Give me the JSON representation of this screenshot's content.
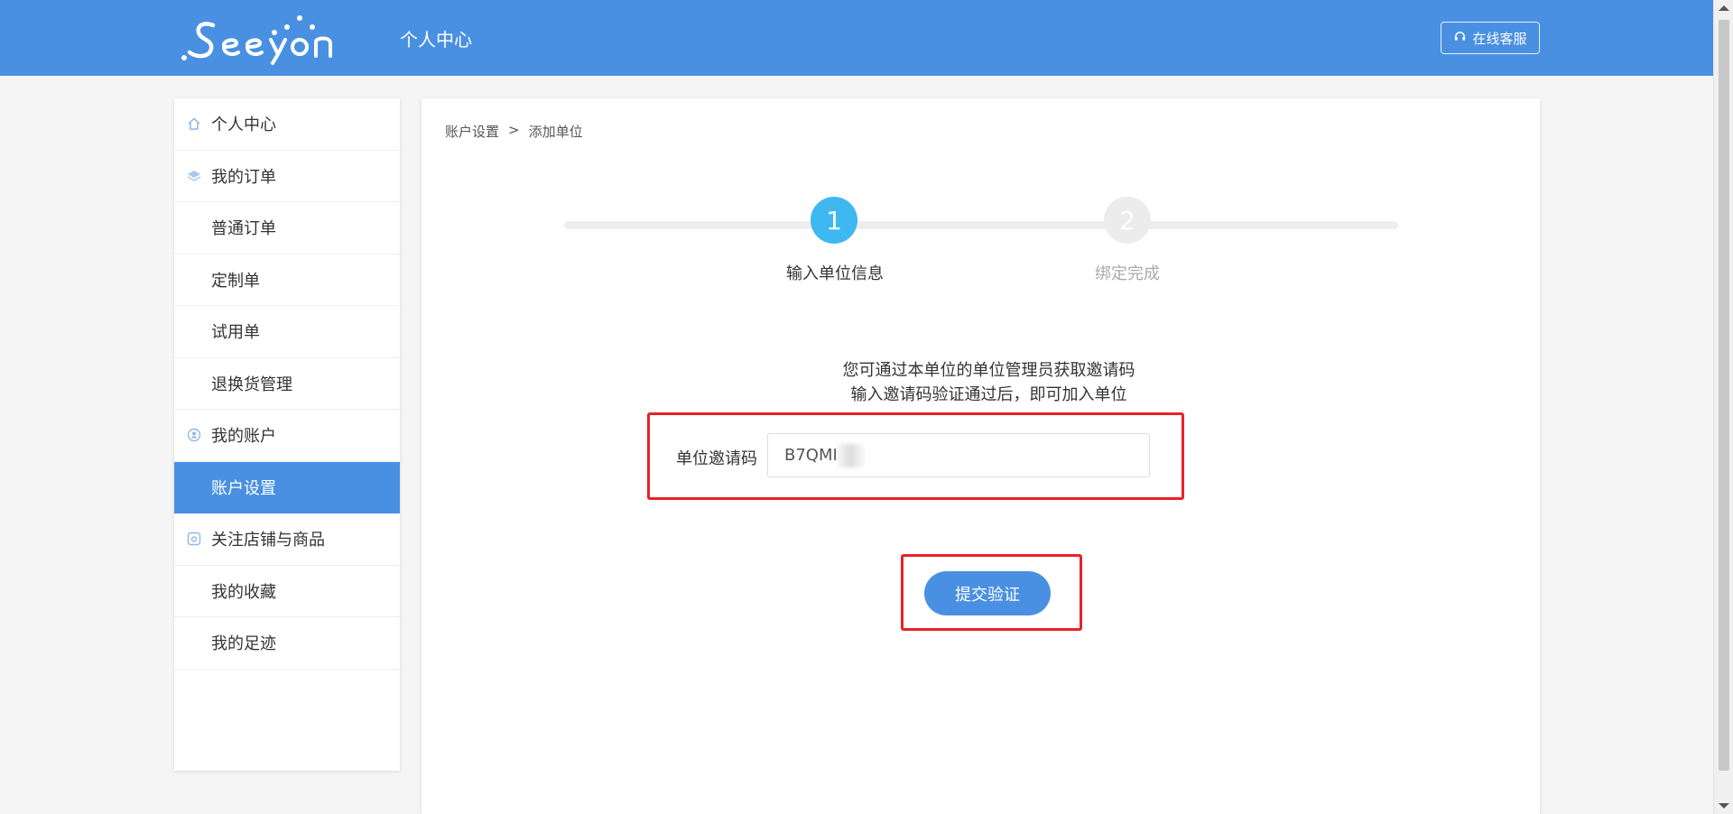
{
  "header": {
    "logo_text": "Seeyon",
    "title": "个人中心",
    "service_button": "在线客服"
  },
  "sidebar": {
    "items": [
      {
        "label": "个人中心",
        "icon": "home-icon"
      },
      {
        "label": "我的订单",
        "icon": "layers-icon"
      },
      {
        "label": "普通订单"
      },
      {
        "label": "定制单"
      },
      {
        "label": "试用单"
      },
      {
        "label": "退换货管理"
      },
      {
        "label": "我的账户",
        "icon": "user-circle-icon"
      },
      {
        "label": "账户设置",
        "active": true
      },
      {
        "label": "关注店铺与商品",
        "icon": "store-icon"
      },
      {
        "label": "我的收藏"
      },
      {
        "label": "我的足迹"
      }
    ]
  },
  "main": {
    "breadcrumb": {
      "parent": "账户设置",
      "separator": ">",
      "current": "添加单位"
    },
    "steps": [
      {
        "number": "1",
        "label": "输入单位信息",
        "status": "active"
      },
      {
        "number": "2",
        "label": "绑定完成",
        "status": "pending"
      }
    ],
    "hint_line1": "您可通过本单位的单位管理员获取邀请码",
    "hint_line2": "输入邀请码验证通过后，即可加入单位",
    "invite_code_label": "单位邀请码",
    "invite_code_value": "B7QMI",
    "submit_button": "提交验证"
  },
  "colors": {
    "brand": "#4a90e2",
    "step_active": "#3fb8f2",
    "annotation": "#e8212a"
  }
}
